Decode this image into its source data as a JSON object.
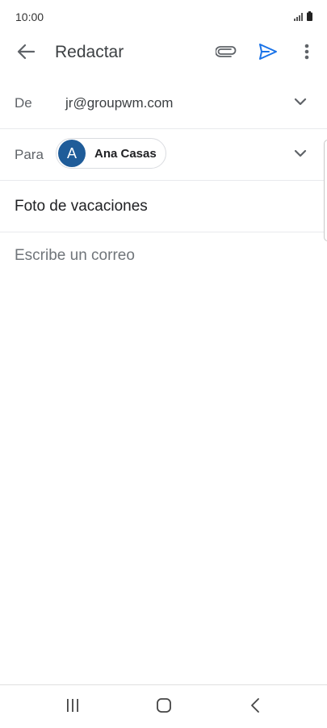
{
  "status_bar": {
    "time": "10:00",
    "icons": [
      "signal-icon",
      "battery-icon"
    ]
  },
  "app_bar": {
    "title": "Redactar",
    "icons": [
      "back-arrow-icon",
      "paperclip-icon",
      "send-icon",
      "more-vert-icon"
    ]
  },
  "compose": {
    "from_label": "De",
    "from_value": "jr@groupwm.com",
    "to_label": "Para",
    "recipient": {
      "initial": "A",
      "name": "Ana Casas"
    },
    "subject": "Foto de vacaciones",
    "body_placeholder": "Escribe un correo"
  },
  "nav_bar": {
    "icons": [
      "recents-icon",
      "home-icon",
      "nav-back-icon"
    ]
  },
  "colors": {
    "accent": "#1a73e8",
    "avatar_bg": "#1f5c99",
    "label": "#5f6368",
    "divider": "#e8eaed"
  }
}
